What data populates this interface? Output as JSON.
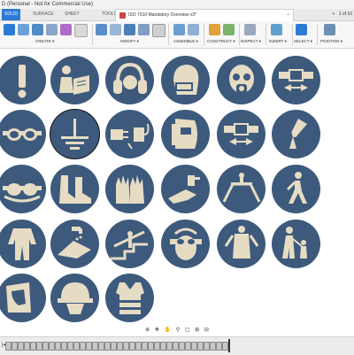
{
  "window": {
    "title": "D (Personal - Not for Commercial Use)"
  },
  "apptabs": [
    "SOLID",
    "SURFACE",
    "SHEET METAL",
    "TOOLS"
  ],
  "document": {
    "title": "ISO 7010 Mandatory Overview v3*",
    "close_glyph": "×",
    "page_indicator": "1 of 10",
    "plus": "+"
  },
  "toolbar_groups": [
    "CREATE ▾",
    "MODIFY ▾",
    "ASSEMBLE ▾",
    "CONSTRUCT ▾",
    "INSPECT ▾",
    "INSERT ▾",
    "SELECT ▾",
    "POSITION ▾"
  ],
  "colors": {
    "sign_blue": "#3d5a7d",
    "symbol": "#e6dcc4",
    "accent": "#2b7bd6"
  },
  "signs": [
    {
      "icon": "exclamation-icon"
    },
    {
      "icon": "read-manual-icon"
    },
    {
      "icon": "ear-protection-icon"
    },
    {
      "icon": "face-mask-icon"
    },
    {
      "icon": "respirator-icon"
    },
    {
      "icon": "seat-belt-icon"
    },
    {
      "icon": "goggles-icon"
    },
    {
      "icon": "earth-ground-icon"
    },
    {
      "icon": "disconnect-plug-icon"
    },
    {
      "icon": "welding-mask-icon"
    },
    {
      "icon": "seat-belt-2-icon"
    },
    {
      "icon": "lever-icon"
    },
    {
      "icon": "opaque-goggles-icon"
    },
    {
      "icon": "safety-boots-icon"
    },
    {
      "icon": "gloves-icon"
    },
    {
      "icon": "hand-cream-icon"
    },
    {
      "icon": "overpass-icon"
    },
    {
      "icon": "pedestrian-icon"
    },
    {
      "icon": "overalls-icon"
    },
    {
      "icon": "wash-hands-icon"
    },
    {
      "icon": "handrail-icon"
    },
    {
      "icon": "face-protection-goggles-icon"
    },
    {
      "icon": "apron-icon"
    },
    {
      "icon": "supervise-child-icon"
    },
    {
      "icon": "face-shield-icon"
    },
    {
      "icon": "hard-hat-icon"
    },
    {
      "icon": "high-vis-vest-icon"
    }
  ],
  "viewnav": [
    "⊕",
    "✥",
    "✋",
    "⚲",
    "▢",
    "⊞",
    "⊟"
  ],
  "timeline": {
    "controls": "|◀ ◀ ▶ ▶|"
  }
}
